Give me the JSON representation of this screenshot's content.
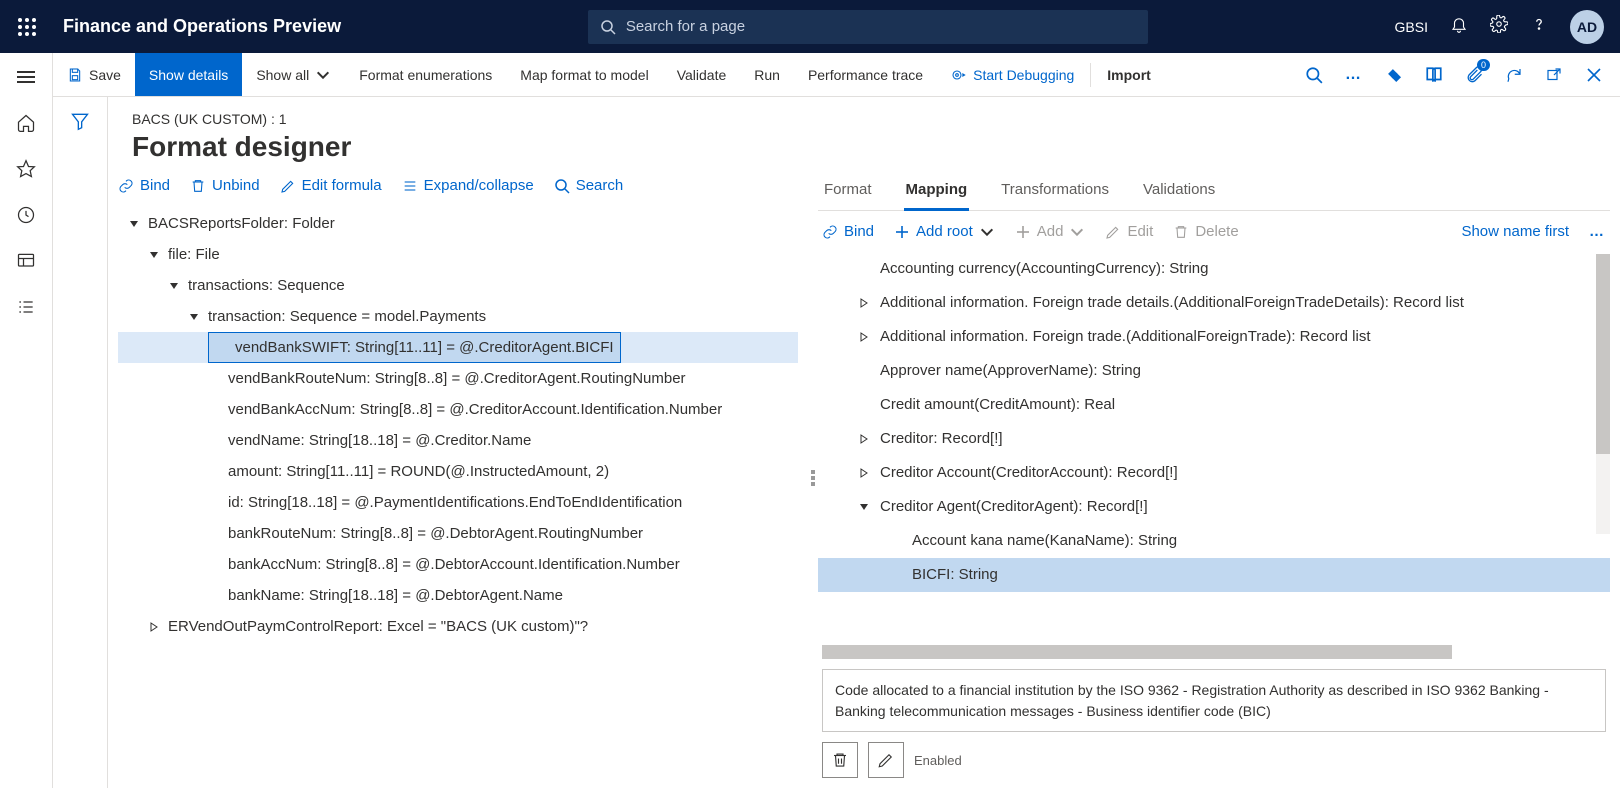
{
  "header": {
    "app_title": "Finance and Operations Preview",
    "search_placeholder": "Search for a page",
    "company": "GBSI",
    "avatar": "AD"
  },
  "actionbar": {
    "save": "Save",
    "show_details": "Show details",
    "show_all": "Show all",
    "format_enum": "Format enumerations",
    "map_model": "Map format to model",
    "validate": "Validate",
    "run": "Run",
    "perf_trace": "Performance trace",
    "start_debug": "Start Debugging",
    "import": "Import",
    "badge": "0"
  },
  "page": {
    "breadcrumb": "BACS (UK CUSTOM) : 1",
    "title": "Format designer"
  },
  "left_toolbar": {
    "bind": "Bind",
    "unbind": "Unbind",
    "edit_formula": "Edit formula",
    "expand": "Expand/collapse",
    "search": "Search"
  },
  "tree": [
    {
      "indent": 0,
      "caret": "down",
      "label": "BACSReportsFolder: Folder"
    },
    {
      "indent": 1,
      "caret": "down",
      "label": "file: File"
    },
    {
      "indent": 2,
      "caret": "down",
      "label": "transactions: Sequence"
    },
    {
      "indent": 3,
      "caret": "down",
      "label": "transaction: Sequence = model.Payments"
    },
    {
      "indent": 4,
      "caret": "",
      "label": "vendBankSWIFT: String[11..11] = @.CreditorAgent.BICFI",
      "selected": true
    },
    {
      "indent": 4,
      "caret": "",
      "label": "vendBankRouteNum: String[8..8] = @.CreditorAgent.RoutingNumber"
    },
    {
      "indent": 4,
      "caret": "",
      "label": "vendBankAccNum: String[8..8] = @.CreditorAccount.Identification.Number"
    },
    {
      "indent": 4,
      "caret": "",
      "label": "vendName: String[18..18] = @.Creditor.Name"
    },
    {
      "indent": 4,
      "caret": "",
      "label": "amount: String[11..11] = ROUND(@.InstructedAmount, 2)"
    },
    {
      "indent": 4,
      "caret": "",
      "label": "id: String[18..18] = @.PaymentIdentifications.EndToEndIdentification"
    },
    {
      "indent": 4,
      "caret": "",
      "label": "bankRouteNum: String[8..8] = @.DebtorAgent.RoutingNumber"
    },
    {
      "indent": 4,
      "caret": "",
      "label": "bankAccNum: String[8..8] = @.DebtorAccount.Identification.Number"
    },
    {
      "indent": 4,
      "caret": "",
      "label": "bankName: String[18..18] = @.DebtorAgent.Name"
    },
    {
      "indent": 1,
      "caret": "right",
      "label": "ERVendOutPaymControlReport: Excel = \"BACS (UK custom)\"?"
    }
  ],
  "right_tabs": {
    "format": "Format",
    "mapping": "Mapping",
    "transformations": "Transformations",
    "validations": "Validations",
    "active": "mapping"
  },
  "right_toolbar": {
    "bind": "Bind",
    "add_root": "Add root",
    "add": "Add",
    "edit": "Edit",
    "delete": "Delete",
    "show_name": "Show name first"
  },
  "right_tree": [
    {
      "level": 1,
      "caret": "",
      "label": "Accounting currency(AccountingCurrency): String"
    },
    {
      "level": 1,
      "caret": "right",
      "label": "Additional information. Foreign trade details.(AdditionalForeignTradeDetails): Record list"
    },
    {
      "level": 1,
      "caret": "right",
      "label": "Additional information. Foreign trade.(AdditionalForeignTrade): Record list"
    },
    {
      "level": 1,
      "caret": "",
      "label": "Approver name(ApproverName): String"
    },
    {
      "level": 1,
      "caret": "",
      "label": "Credit amount(CreditAmount): Real"
    },
    {
      "level": 1,
      "caret": "right",
      "label": "Creditor: Record[!]"
    },
    {
      "level": 1,
      "caret": "right",
      "label": "Creditor Account(CreditorAccount): Record[!]"
    },
    {
      "level": 1,
      "caret": "down",
      "label": "Creditor Agent(CreditorAgent): Record[!]"
    },
    {
      "level": 2,
      "caret": "",
      "label": "Account kana name(KanaName): String"
    },
    {
      "level": 2,
      "caret": "",
      "label": "BICFI: String",
      "selected": true
    }
  ],
  "description": "Code allocated to a financial institution by the ISO 9362 - Registration Authority as described in ISO 9362 Banking - Banking telecommunication messages - Business identifier code (BIC)",
  "enabled_label": "Enabled"
}
